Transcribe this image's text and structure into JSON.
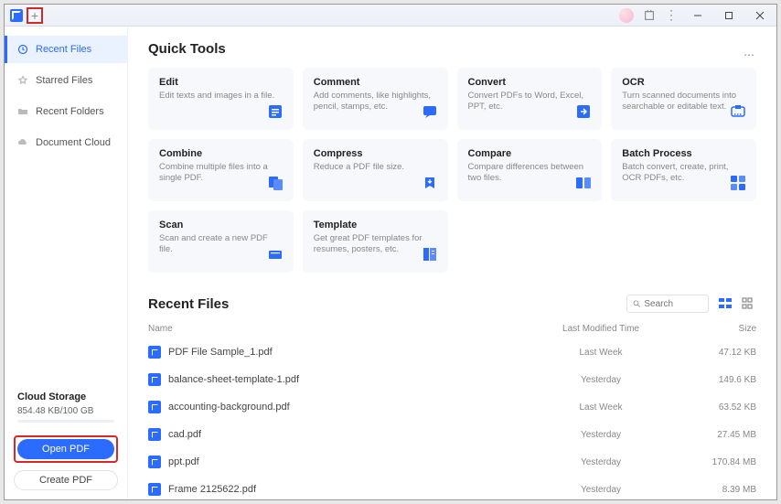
{
  "sidebar": {
    "items": [
      {
        "label": "Recent Files"
      },
      {
        "label": "Starred Files"
      },
      {
        "label": "Recent Folders"
      },
      {
        "label": "Document Cloud"
      }
    ],
    "cloud_title": "Cloud Storage",
    "cloud_usage": "854.48 KB/100 GB",
    "open_pdf": "Open PDF",
    "create_pdf": "Create PDF"
  },
  "quick_tools_title": "Quick Tools",
  "tools": [
    {
      "title": "Edit",
      "desc": "Edit texts and images in a file."
    },
    {
      "title": "Comment",
      "desc": "Add comments, like highlights, pencil, stamps, etc."
    },
    {
      "title": "Convert",
      "desc": "Convert PDFs to Word, Excel, PPT, etc."
    },
    {
      "title": "OCR",
      "desc": "Turn scanned documents into searchable or editable text."
    },
    {
      "title": "Combine",
      "desc": "Combine multiple files into a single PDF."
    },
    {
      "title": "Compress",
      "desc": "Reduce a PDF file size."
    },
    {
      "title": "Compare",
      "desc": "Compare differences between two files."
    },
    {
      "title": "Batch Process",
      "desc": "Batch convert, create, print, OCR PDFs, etc."
    },
    {
      "title": "Scan",
      "desc": "Scan and create a new PDF file."
    },
    {
      "title": "Template",
      "desc": "Get great PDF templates for resumes, posters, etc."
    }
  ],
  "recent_files_title": "Recent Files",
  "search_placeholder": "Search",
  "columns": {
    "name": "Name",
    "modified": "Last Modified Time",
    "size": "Size"
  },
  "files": [
    {
      "name": "PDF File Sample_1.pdf",
      "modified": "Last Week",
      "size": "47.12 KB"
    },
    {
      "name": "balance-sheet-template-1.pdf",
      "modified": "Yesterday",
      "size": "149.6 KB"
    },
    {
      "name": "accounting-background.pdf",
      "modified": "Last Week",
      "size": "63.52 KB"
    },
    {
      "name": "cad.pdf",
      "modified": "Yesterday",
      "size": "27.45 MB"
    },
    {
      "name": "ppt.pdf",
      "modified": "Yesterday",
      "size": "170.84 MB"
    },
    {
      "name": "Frame 2125622.pdf",
      "modified": "Yesterday",
      "size": "8.39 MB"
    }
  ]
}
